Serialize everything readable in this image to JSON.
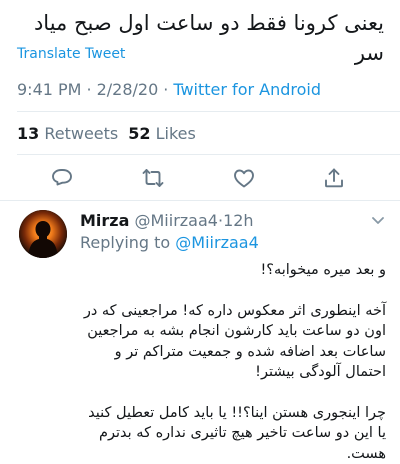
{
  "tweet": {
    "text": "یعنی کرونا فقط دو ساعت اول صبح میاد سر",
    "translate_label": "Translate Tweet",
    "time": "9:41 PM",
    "date": "2/28/20",
    "separator": "·",
    "client": "Twitter for Android",
    "retweets_count": "13",
    "retweets_label": "Retweets",
    "likes_count": "52",
    "likes_label": "Likes"
  },
  "actions": {
    "icons": [
      "reply-icon",
      "retweet-icon",
      "like-icon",
      "share-icon"
    ],
    "color": "#657786"
  },
  "reply": {
    "name": "Mirza",
    "handle": "@Miirzaa4",
    "separator": "·",
    "age": "12h",
    "replying_prefix": "Replying to",
    "replying_to": "@Miirzaa4",
    "paragraphs": [
      "و بعد میره میخوابه؟!",
      "آخه اینطوری اثر معکوس داره که! مراجعینی که در اون دو ساعت باید کارشون انجام بشه به مراجعین ساعات بعد اضافه شده و جمعیت متراکم تر و احتمال آلودگی بیشتر!",
      "چرا اینجوری هستن اینا؟!! یا باید کامل تعطیل کنید یا این دو ساعت تاخیر هیچ تاثیری نداره که بدترم هست."
    ]
  },
  "colors": {
    "link": "#1b95e0",
    "secondary_text": "#657786",
    "primary_text": "#14171a",
    "divider": "#e6ecf0"
  }
}
